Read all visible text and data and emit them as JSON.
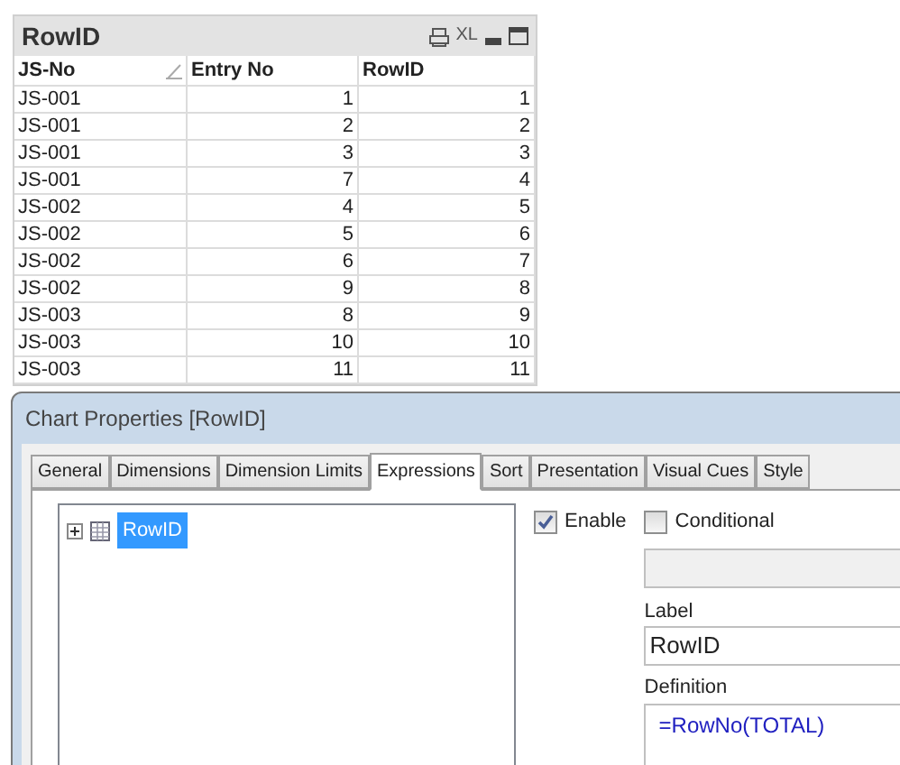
{
  "table_box": {
    "title": "RowID",
    "caption_text": "XL",
    "columns": [
      {
        "label": "JS-No",
        "sorted": true
      },
      {
        "label": "Entry No",
        "sorted": false
      },
      {
        "label": "RowID",
        "sorted": false
      }
    ],
    "rows": [
      [
        "JS-001",
        "1",
        "1"
      ],
      [
        "JS-001",
        "2",
        "2"
      ],
      [
        "JS-001",
        "3",
        "3"
      ],
      [
        "JS-001",
        "7",
        "4"
      ],
      [
        "JS-002",
        "4",
        "5"
      ],
      [
        "JS-002",
        "5",
        "6"
      ],
      [
        "JS-002",
        "6",
        "7"
      ],
      [
        "JS-002",
        "9",
        "8"
      ],
      [
        "JS-003",
        "8",
        "9"
      ],
      [
        "JS-003",
        "10",
        "10"
      ],
      [
        "JS-003",
        "11",
        "11"
      ]
    ]
  },
  "dialog": {
    "title": "Chart Properties [RowID]",
    "tabs": [
      {
        "label": "General",
        "selected": false
      },
      {
        "label": "Dimensions",
        "selected": false
      },
      {
        "label": "Dimension Limits",
        "selected": false
      },
      {
        "label": "Expressions",
        "selected": true
      },
      {
        "label": "Sort",
        "selected": false
      },
      {
        "label": "Presentation",
        "selected": false
      },
      {
        "label": "Visual Cues",
        "selected": false
      },
      {
        "label": "Style",
        "selected": false
      }
    ],
    "tree": [
      {
        "label": "RowID",
        "selected": true,
        "expanded": false
      }
    ],
    "enable": {
      "label": "Enable",
      "checked": true
    },
    "conditional": {
      "label": "Conditional",
      "checked": false
    },
    "label_field": {
      "label": "Label",
      "value": "RowID"
    },
    "definition_field": {
      "label": "Definition",
      "value": "=RowNo(TOTAL)"
    }
  }
}
